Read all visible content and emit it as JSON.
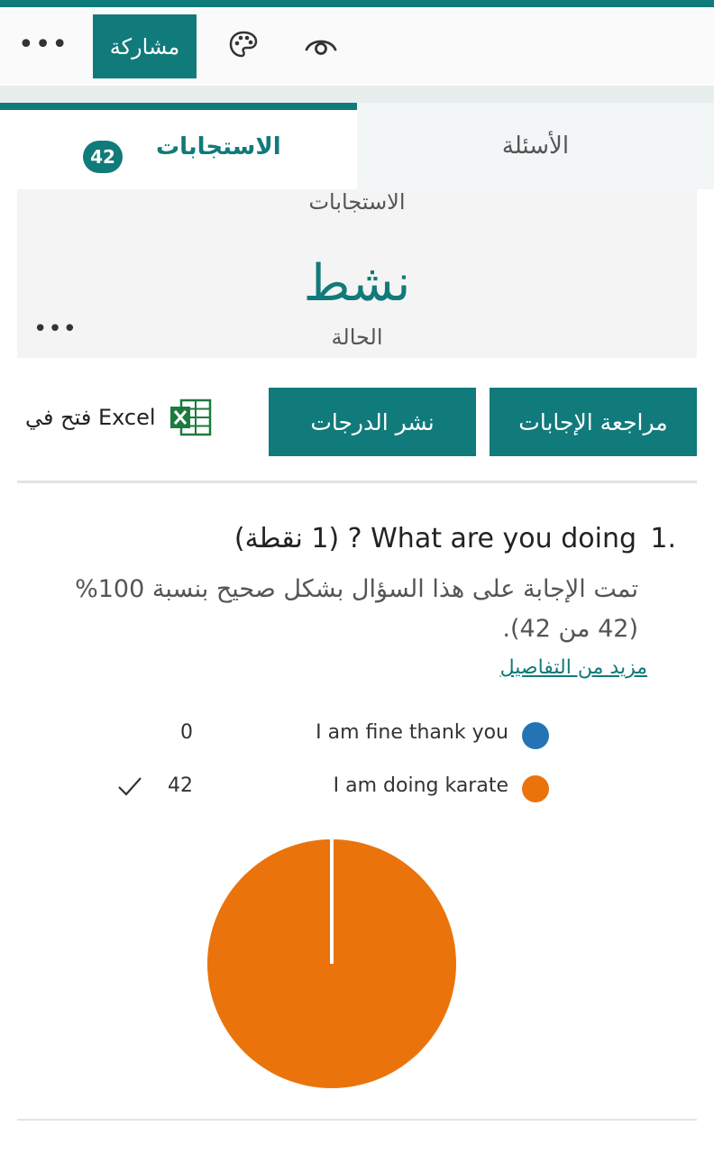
{
  "topbar": {
    "more_label": "•••",
    "share_label": "مشاركة",
    "icons": [
      "palette-icon",
      "eye-icon"
    ]
  },
  "tabs": {
    "questions_label": "الأسئلة",
    "responses_label": "الاستجابات",
    "responses_count": "42"
  },
  "status_card": {
    "caption": "الاستجابات",
    "status_value": "نشط",
    "status_label": "الحالة",
    "more_label": "•••"
  },
  "actions": {
    "review_label": "مراجعة الإجابات",
    "publish_label": "نشر الدرجات",
    "excel_label": "فتح في Excel"
  },
  "question": {
    "number": "1.",
    "title": "What are you doing ? (1 نقطة)",
    "description": "تمت الإجابة على هذا السؤال بشكل صحيح بنسبة 100% (42 من 42).",
    "more_details_label": "مزيد من التفاصيل",
    "options": [
      {
        "label": "I am fine thank you",
        "count": "0",
        "color": "#2474b5",
        "correct": false
      },
      {
        "label": "I am doing karate",
        "count": "42",
        "color": "#ea730c",
        "correct": true
      }
    ]
  },
  "chart_data": {
    "type": "pie",
    "categories": [
      "I am fine thank you",
      "I am doing karate"
    ],
    "values": [
      0,
      42
    ],
    "colors": [
      "#2474b5",
      "#ea730c"
    ]
  }
}
